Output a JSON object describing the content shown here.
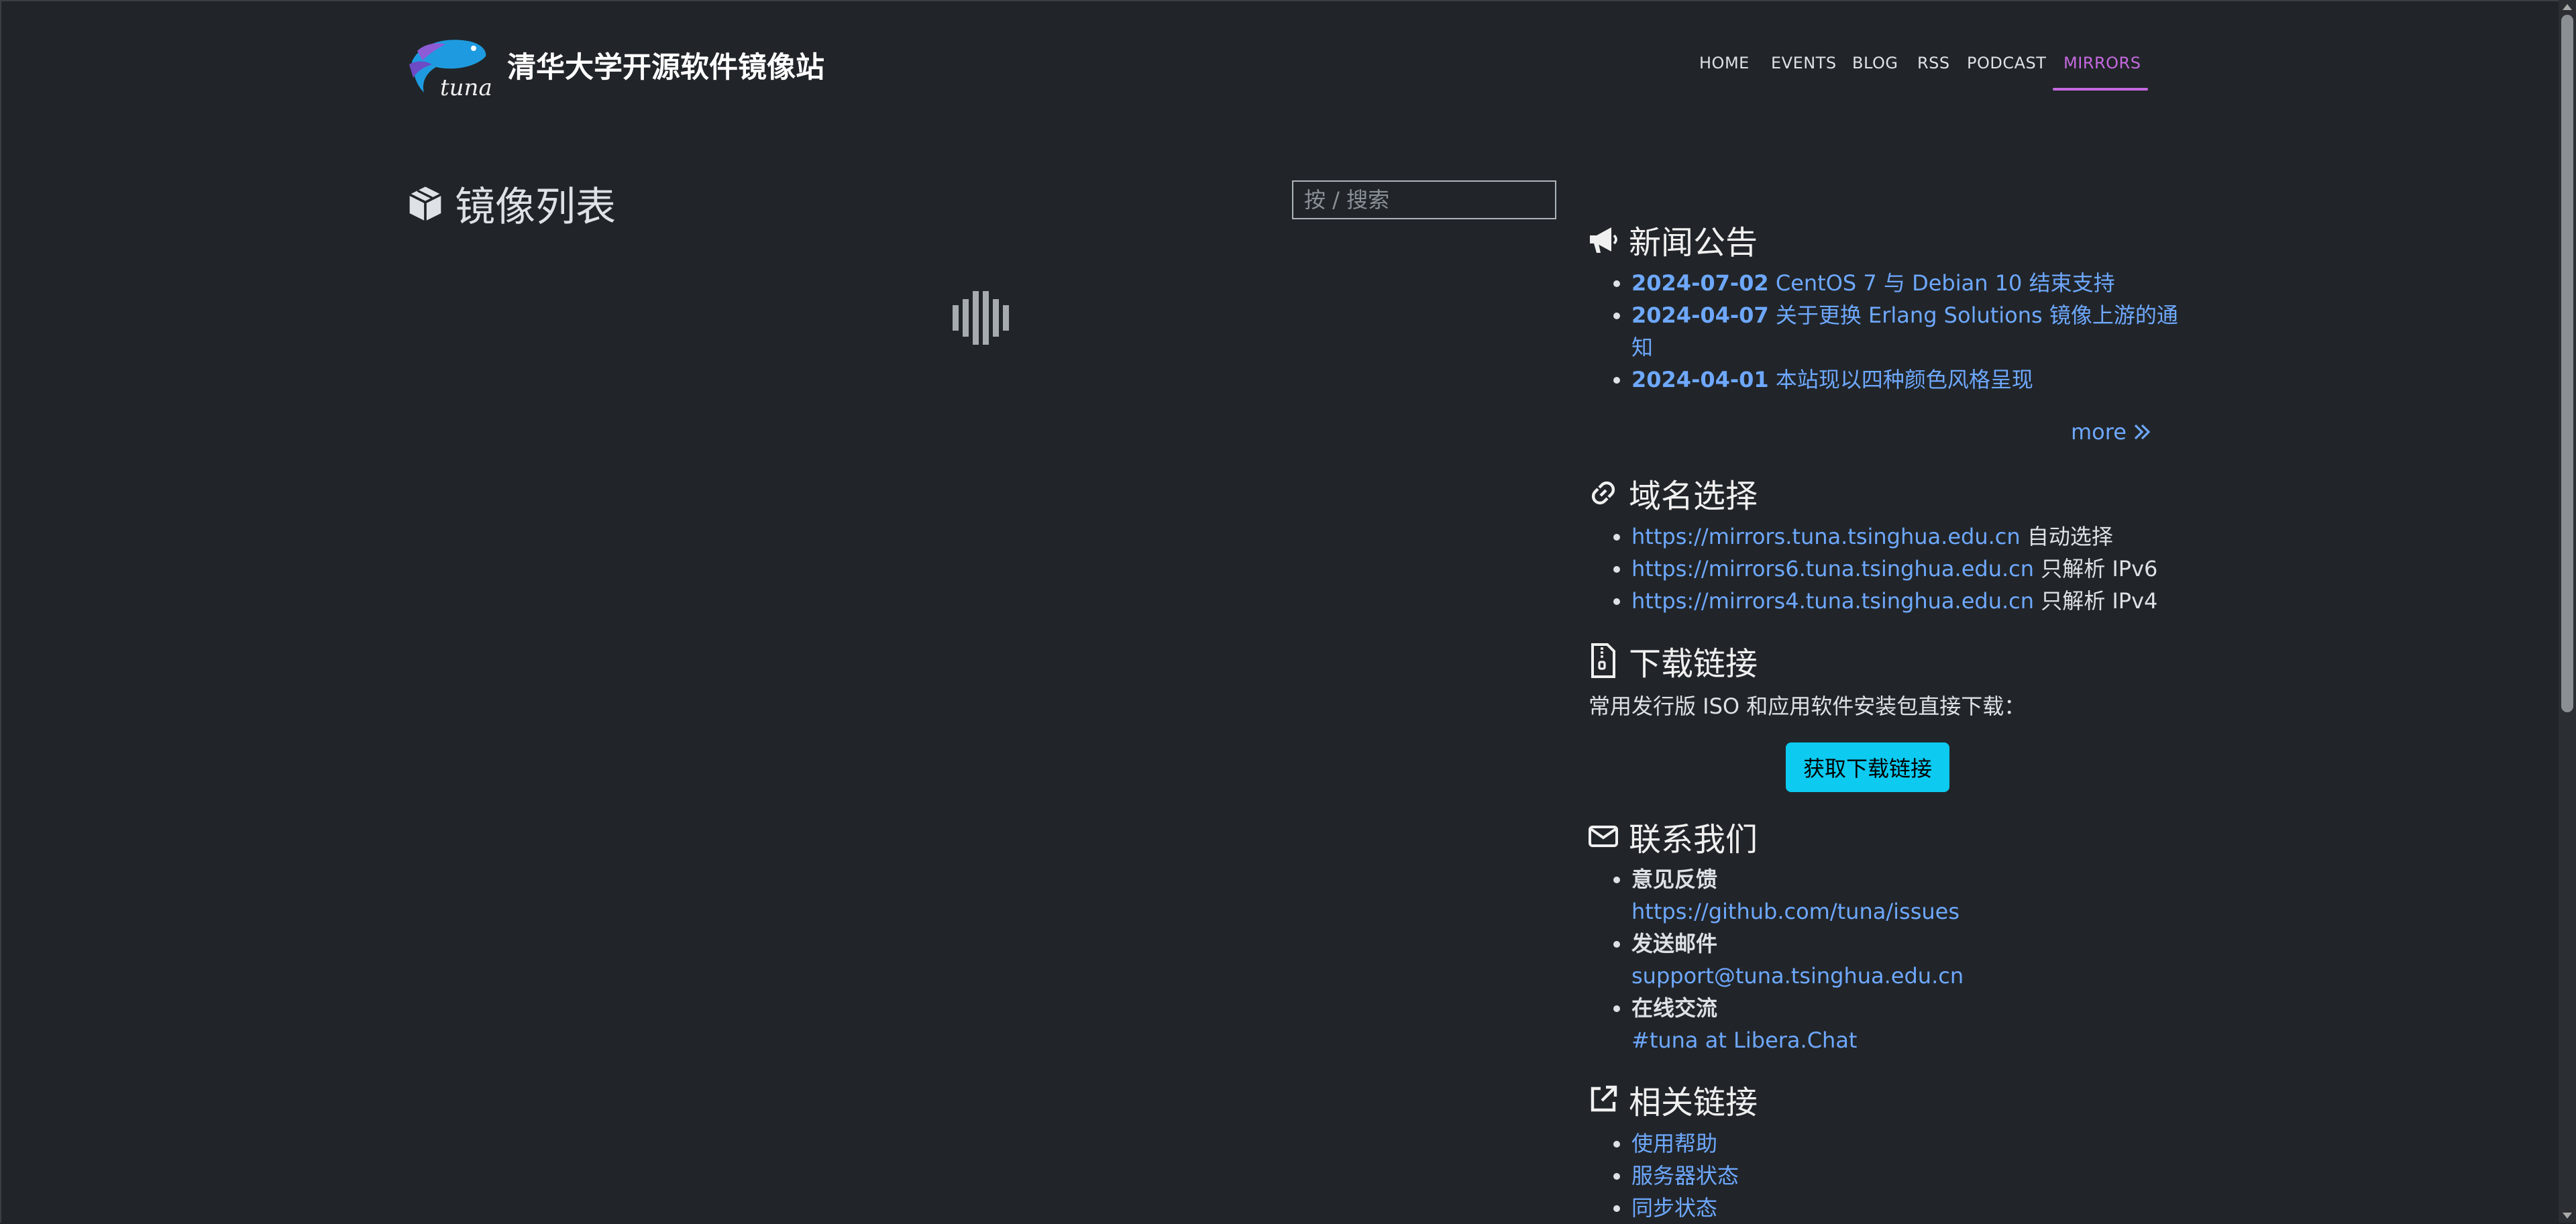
{
  "header": {
    "logo_text": "tuna",
    "site_title": "清华大学开源软件镜像站",
    "nav": [
      {
        "label": "HOME",
        "active": false
      },
      {
        "label": "EVENTS",
        "active": false
      },
      {
        "label": "BLOG",
        "active": false
      },
      {
        "label": "RSS",
        "active": false
      },
      {
        "label": "PODCAST",
        "active": false
      },
      {
        "label": "MIRRORS",
        "active": true
      }
    ]
  },
  "mirror_list": {
    "title": "镜像列表",
    "search_placeholder": "按 / 搜索",
    "loading": true
  },
  "news": {
    "title": "新闻公告",
    "items": [
      {
        "date": "2024-07-02",
        "text": "CentOS 7 与 Debian 10 结束支持"
      },
      {
        "date": "2024-04-07",
        "text": "关于更换 Erlang Solutions 镜像上游的通知"
      },
      {
        "date": "2024-04-01",
        "text": "本站现以四种颜色风格呈现"
      }
    ],
    "more_label": "more"
  },
  "domains": {
    "title": "域名选择",
    "items": [
      {
        "url": "https://mirrors.tuna.tsinghua.edu.cn",
        "note": "自动选择"
      },
      {
        "url": "https://mirrors6.tuna.tsinghua.edu.cn",
        "note": "只解析 IPv6"
      },
      {
        "url": "https://mirrors4.tuna.tsinghua.edu.cn",
        "note": "只解析 IPv4"
      }
    ]
  },
  "downloads": {
    "title": "下载链接",
    "text": "常用发行版 ISO 和应用软件安装包直接下载：",
    "button": "获取下载链接"
  },
  "contact": {
    "title": "联系我们",
    "items": [
      {
        "label": "意见反馈",
        "link": "https://github.com/tuna/issues"
      },
      {
        "label": "发送邮件",
        "link": "support@tuna.tsinghua.edu.cn"
      },
      {
        "label": "在线交流",
        "link": "#tuna at Libera.Chat"
      }
    ]
  },
  "related": {
    "title": "相关链接",
    "items": [
      "使用帮助",
      "服务器状态",
      "同步状态"
    ]
  },
  "colors": {
    "background": "#212529",
    "link": "#6ea8fe",
    "active_nav": "#c569e0",
    "button": "#0dcaf0"
  }
}
